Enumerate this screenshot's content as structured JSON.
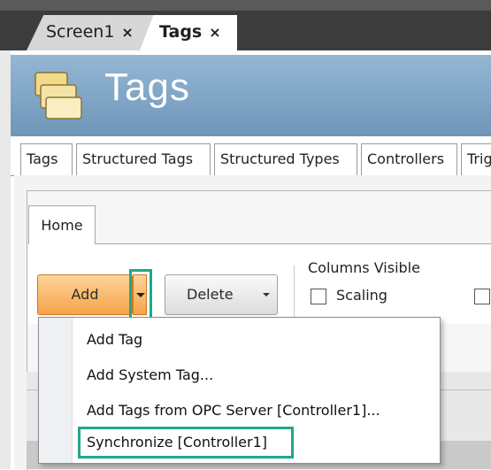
{
  "doc_tabs": [
    {
      "label": "Screen1",
      "close": "×"
    },
    {
      "label": "Tags",
      "close": "×"
    }
  ],
  "header": {
    "title": "Tags",
    "icon": "folder-stack-icon"
  },
  "tag_tabs": [
    "Tags",
    "Structured Tags",
    "Structured Types",
    "Controllers",
    "Trig"
  ],
  "ribbon": {
    "home_tab": "Home",
    "add_label": "Add",
    "delete_label": "Delete",
    "columns_visible_label": "Columns Visible",
    "scaling_label": "Scaling"
  },
  "add_menu": {
    "items": [
      "Add Tag",
      "Add System Tag...",
      "Add Tags from OPC Server [Controller1]...",
      "Synchronize [Controller1]"
    ]
  },
  "colors": {
    "highlight": "#22a78b",
    "accent_orange": "#f6a348",
    "banner": "#7fa3c4"
  }
}
